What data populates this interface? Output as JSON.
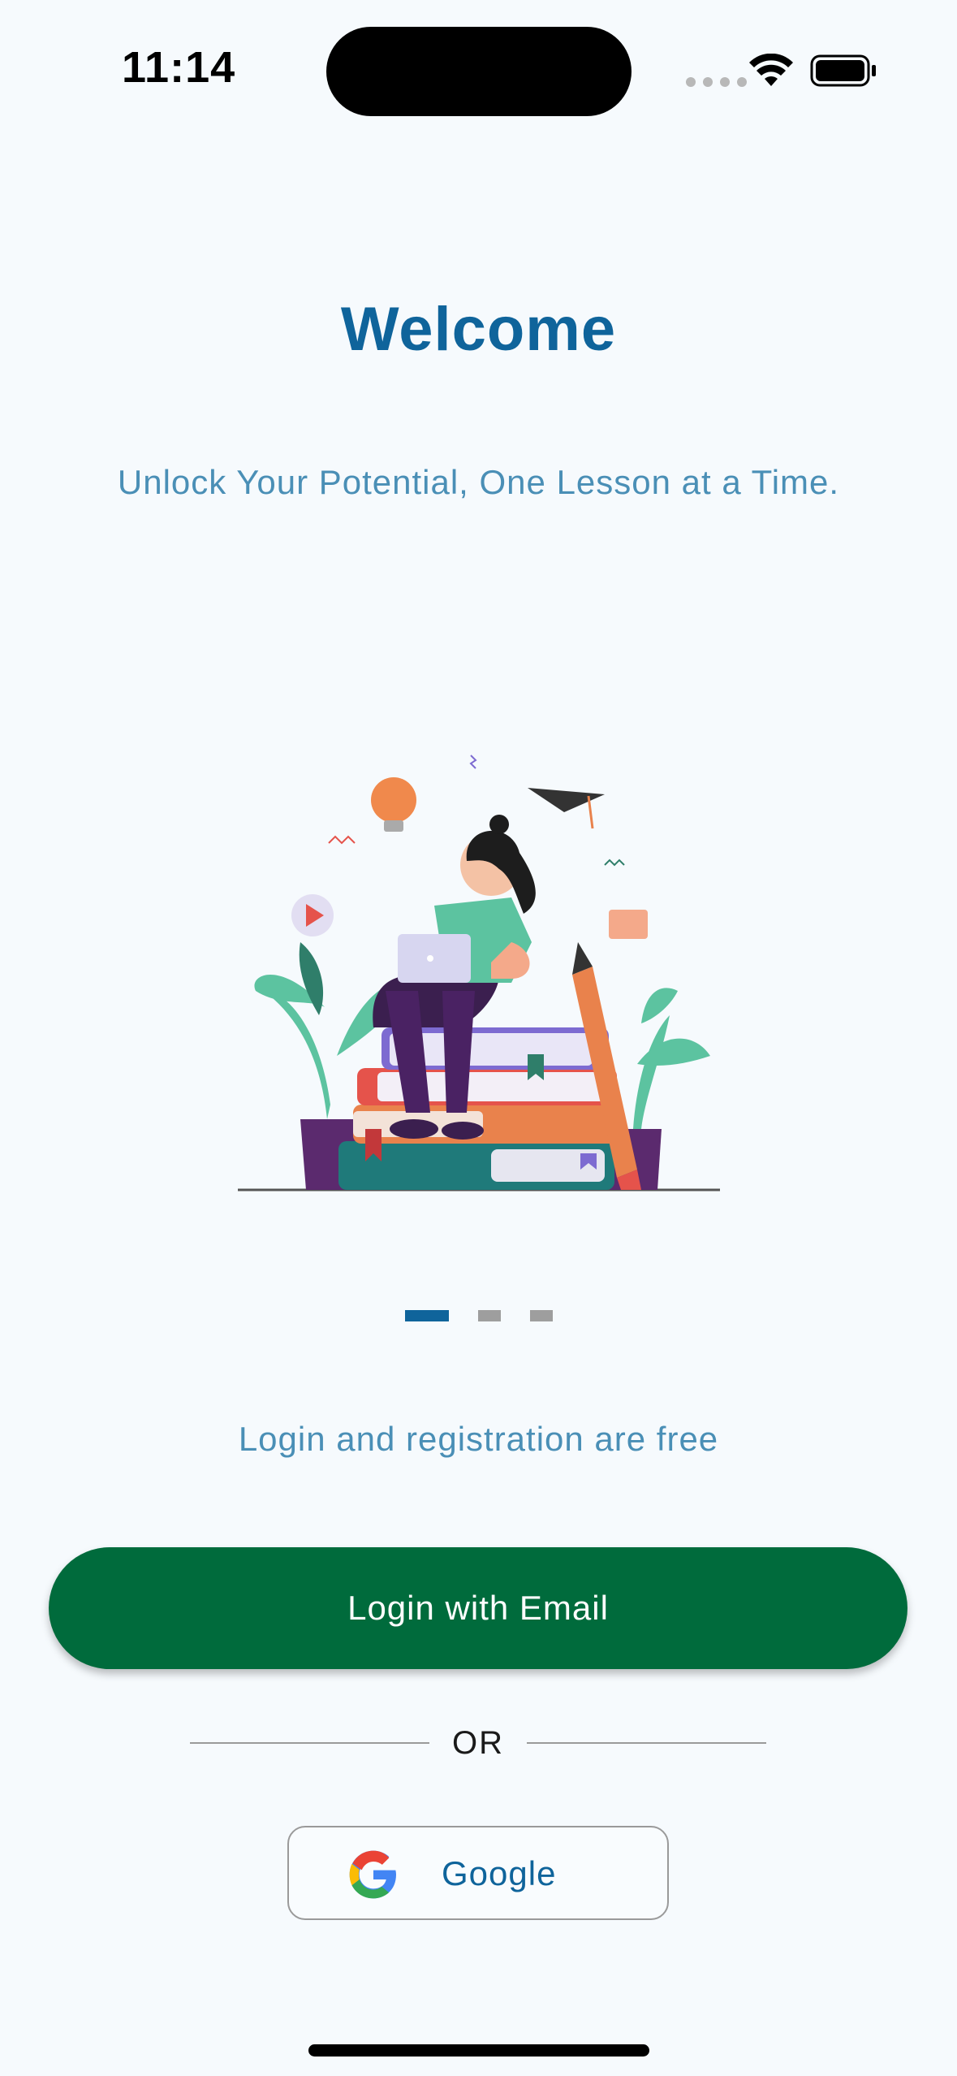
{
  "status_bar": {
    "time": "11:14",
    "icons": [
      "signal-icon",
      "wifi-icon",
      "battery-icon"
    ]
  },
  "welcome": {
    "title": "Welcome",
    "subtitle": "Unlock Your Potential, One Lesson at a Time."
  },
  "illustration": {
    "icon": "student-studying-illustration"
  },
  "carousel": {
    "pages": 3,
    "active_page": 1
  },
  "auth": {
    "free_note": "Login and registration are free",
    "email_button_label": "Login with Email",
    "or_label": "OR",
    "google_button_label": "Google",
    "google_icon": "google-logo-icon"
  },
  "colors": {
    "background": "#f6fafd",
    "title": "#0f649b",
    "subtitle": "#4a8fb6",
    "primary_button": "#006b3c",
    "active_dot": "#0f649b",
    "inactive_dot": "#9e9e9e"
  }
}
